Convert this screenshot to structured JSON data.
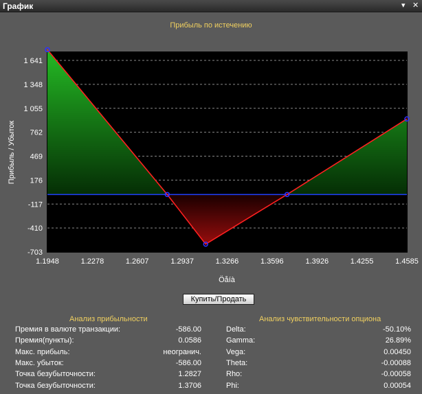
{
  "window": {
    "title": "График",
    "pin_icon": "pin-icon",
    "close_icon": "close-icon"
  },
  "chart_data": {
    "type": "area",
    "title": "Прибыль по истечению",
    "xlabel": "Öåíà",
    "ylabel": "Прибыль / Убыток",
    "x": [
      1.1948,
      1.2827,
      1.3109,
      1.3706,
      1.4585
    ],
    "y": [
      1772,
      0,
      -608,
      0,
      925
    ],
    "xlim": [
      1.1948,
      1.4585
    ],
    "ylim": [
      -703,
      1934
    ],
    "x_ticks": [
      "1.1948",
      "1.2278",
      "1.2607",
      "1.2937",
      "1.3266",
      "1.3596",
      "1.3926",
      "1.4255",
      "1.4585"
    ],
    "x_tick_values": [
      1.1948,
      1.2278,
      1.2607,
      1.2937,
      1.3266,
      1.3596,
      1.3926,
      1.4255,
      1.4585
    ],
    "y_ticks": [
      "-703",
      "-410",
      "-117",
      "176",
      "469",
      "762",
      "1 055",
      "1 348",
      "1 641"
    ],
    "y_tick_values": [
      -703,
      -410,
      -117,
      176,
      469,
      762,
      1055,
      1348,
      1641
    ],
    "zero_line": 0,
    "grid": true,
    "colors": {
      "profit": "#1aa01a",
      "loss": "#b01010",
      "line": "#ff2020",
      "zero": "#2040ff",
      "marker": "#3030ff",
      "plot_bg": "#000000"
    }
  },
  "action_button": {
    "label": "Купить/Продать"
  },
  "profitability": {
    "title": "Анализ прибыльности",
    "rows": [
      {
        "label": "Премия в валюте транзакции:",
        "value": "-586.00"
      },
      {
        "label": "Премия(пункты):",
        "value": "0.0586"
      },
      {
        "label": "Макс. прибыль:",
        "value": "неогранич."
      },
      {
        "label": "Макс. убыток:",
        "value": "-586.00"
      },
      {
        "label": "Точка безубыточности:",
        "value": "1.2827"
      },
      {
        "label": "Точка безубыточности:",
        "value": "1.3706"
      }
    ]
  },
  "sensitivity": {
    "title": "Анализ чувствительности опциона",
    "rows": [
      {
        "label": "Delta:",
        "value": "-50.10%"
      },
      {
        "label": "Gamma:",
        "value": "26.89%"
      },
      {
        "label": "Vega:",
        "value": "0.00450"
      },
      {
        "label": "Theta:",
        "value": "-0.00088"
      },
      {
        "label": "Rho:",
        "value": "-0.00058"
      },
      {
        "label": "Phi:",
        "value": "0.00054"
      }
    ]
  }
}
